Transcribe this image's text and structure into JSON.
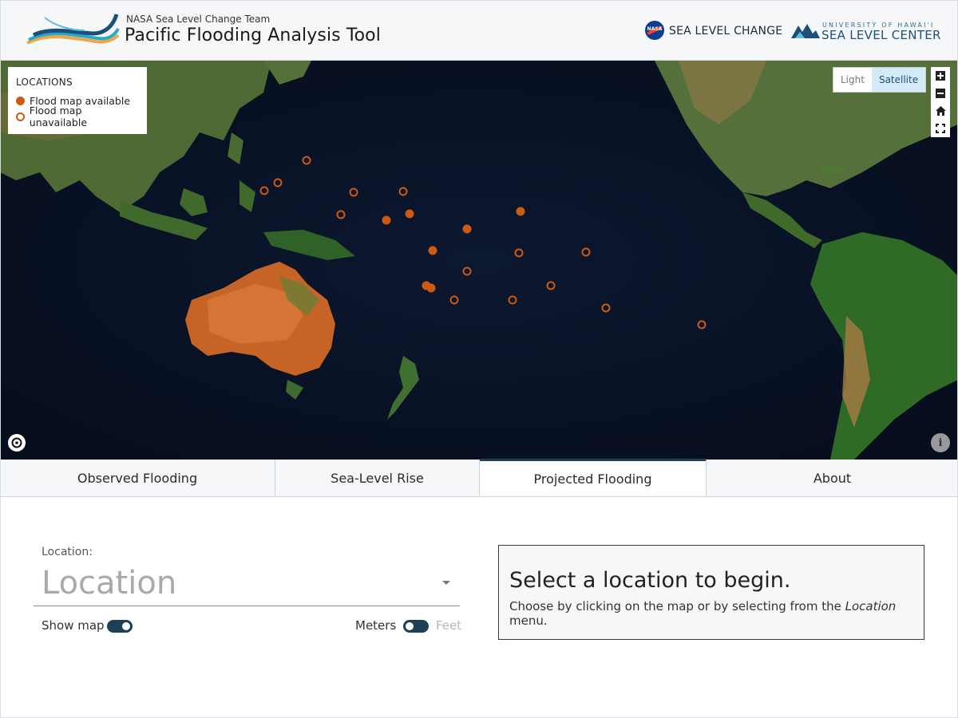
{
  "header": {
    "subtitle": "NASA Sea Level Change Team",
    "title": "Pacific Flooding Analysis Tool",
    "nasa_badge_text": "NASA",
    "sea_level_change_label": "SEA LEVEL CHANGE",
    "uh_top_label": "UNIVERSITY OF HAWAI'I",
    "uh_main_label": "SEA LEVEL CENTER"
  },
  "map": {
    "legend": {
      "title": "LOCATIONS",
      "available_label": "Flood map available",
      "unavailable_label": "Flood map unavailable"
    },
    "basemap": {
      "light_label": "Light",
      "satellite_label": "Satellite",
      "active": "Satellite"
    },
    "controls": {
      "zoom_in": "+",
      "zoom_out": "−",
      "home": "⌂",
      "fullscreen": "⛶",
      "info": "i"
    },
    "marker_color": "#cc5a13"
  },
  "tabs": [
    {
      "label": "Observed Flooding",
      "active": false
    },
    {
      "label": "Sea-Level Rise",
      "active": false
    },
    {
      "label": "Projected Flooding",
      "active": true
    },
    {
      "label": "About",
      "active": false
    }
  ],
  "form": {
    "location_label": "Location:",
    "location_placeholder": "Location",
    "show_map_label": "Show map",
    "show_map_on": true,
    "meters_label": "Meters",
    "feet_label": "Feet",
    "units_selected": "Meters"
  },
  "info": {
    "heading": "Select a location to begin.",
    "text_before": "Choose by clicking on the map or by selecting from the ",
    "text_em": "Location",
    "text_after": " menu."
  },
  "colors": {
    "accent": "#1d4057",
    "marker": "#cc5a13",
    "header_bg": "#f6f7f9"
  }
}
